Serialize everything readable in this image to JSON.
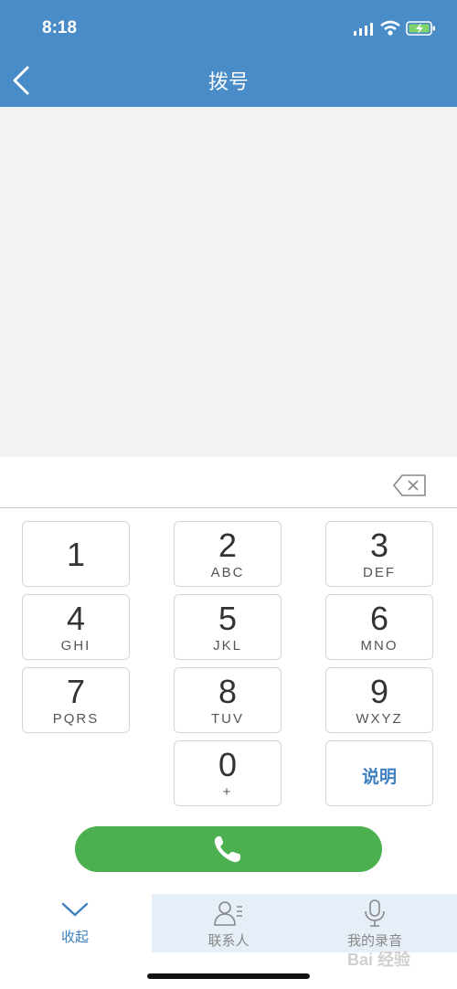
{
  "status_bar": {
    "time": "8:18"
  },
  "header": {
    "title": "拨号"
  },
  "keypad": {
    "keys": [
      {
        "digit": "1",
        "letters": ""
      },
      {
        "digit": "2",
        "letters": "ABC"
      },
      {
        "digit": "3",
        "letters": "DEF"
      },
      {
        "digit": "4",
        "letters": "GHI"
      },
      {
        "digit": "5",
        "letters": "JKL"
      },
      {
        "digit": "6",
        "letters": "MNO"
      },
      {
        "digit": "7",
        "letters": "PQRS"
      },
      {
        "digit": "8",
        "letters": "TUV"
      },
      {
        "digit": "9",
        "letters": "WXYZ"
      },
      {
        "digit": "0",
        "letters": "+"
      }
    ],
    "help_label": "说明"
  },
  "tabs": [
    {
      "label": "收起",
      "icon": "chevron-down-icon",
      "color": "#3e80c2"
    },
    {
      "label": "联系人",
      "icon": "contacts-icon",
      "color": "#888888"
    },
    {
      "label": "我的录音",
      "icon": "microphone-icon",
      "color": "#888888"
    }
  ],
  "watermark": "Bai 经验"
}
